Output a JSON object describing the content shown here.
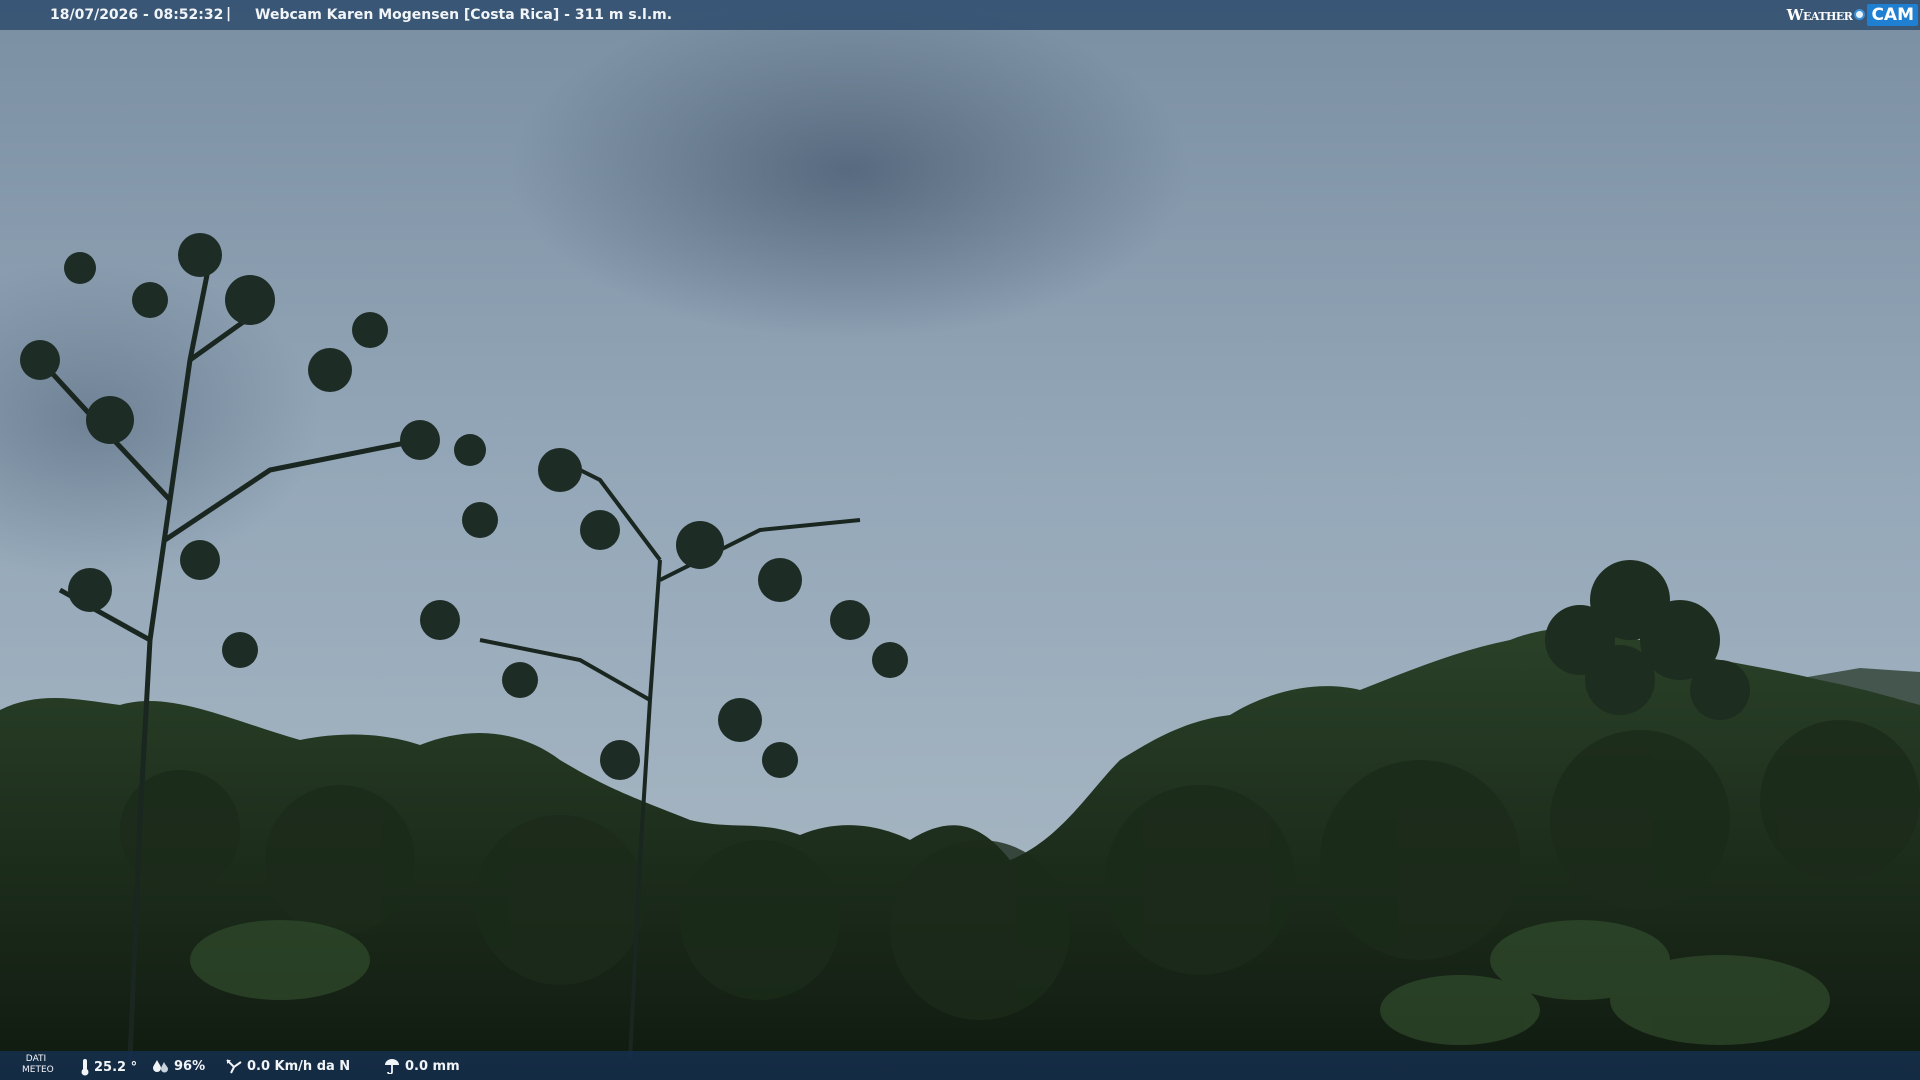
{
  "overlay": {
    "timestamp": "18/07/2026 - 08:52:32",
    "separator": "|",
    "title": "Webcam Karen Mogensen [Costa Rica]  - 311 m s.l.m.",
    "logo_left": "Weather",
    "logo_right": "CAM"
  },
  "weather": {
    "label_line1": "DATI",
    "label_line2": "METEO",
    "temperature": "25.2 °",
    "humidity": "96%",
    "wind": "0.0 Km/h da N",
    "rain": "0.0 mm",
    "icons": [
      "thermometer-icon",
      "humidity-icon",
      "wind-icon",
      "rain-gauge-icon"
    ]
  },
  "scene": {
    "description_free": true,
    "colors": {
      "sky_top": "#7f93a7",
      "sky_mid": "#97aabb",
      "sky_low": "#a6b6c3",
      "cloud_dark": "#56687c",
      "hill": "#4a5a52",
      "forest_dark": "#152116",
      "forest_mid": "#243a22",
      "leaf": "#1d2f22"
    }
  }
}
